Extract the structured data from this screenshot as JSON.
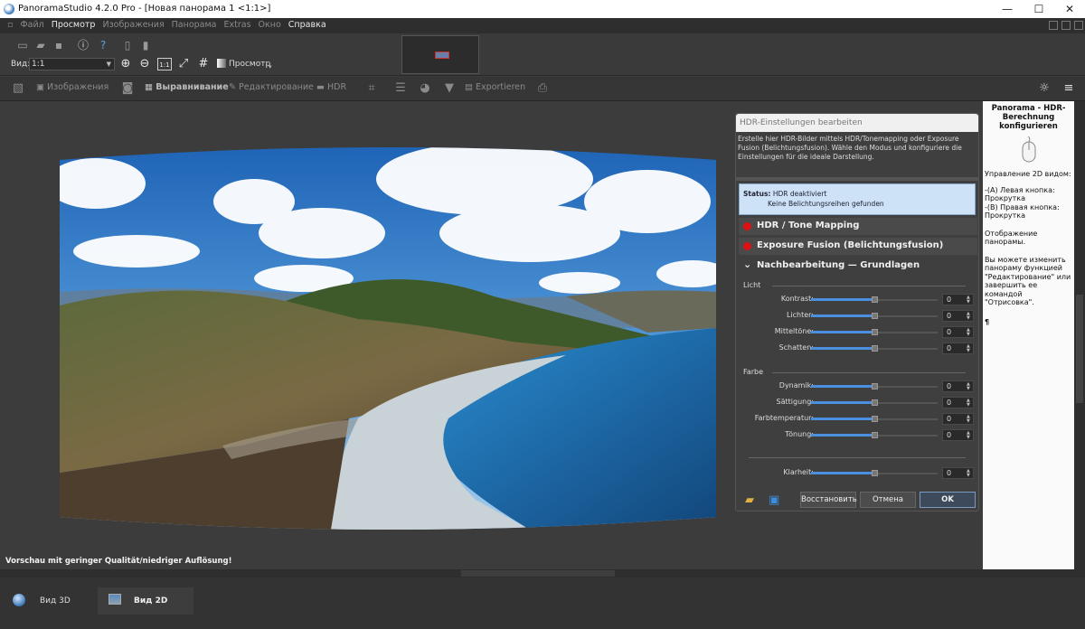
{
  "window": {
    "title": "PanoramaStudio 4.2.0 Pro - [Новая панорама 1 <1:1>]",
    "minimize": "—",
    "maximize": "☐",
    "close": "✕"
  },
  "menu": [
    "Файл",
    "Просмотр",
    "Изображения",
    "Панорама",
    "Extras",
    "Окно",
    "Справка"
  ],
  "toolbar": {
    "view_label": "Вид:",
    "zoom_value": "1:1",
    "zoom_1to1": "1:1",
    "preview_label": "Просмотр"
  },
  "workflow": {
    "images": "Изображения",
    "align": "Выравнивание",
    "edit": "Редактирование",
    "hdr": "HDR",
    "export": "Exportieren"
  },
  "canvas": {
    "preview_note": "Vorschau mit geringer Qualität/niedriger Auflösung!"
  },
  "help": {
    "title": "Panorama - HDR-Berechnung konfigurieren",
    "p1": "Управление 2D видом:",
    "p2": "-(A) Левая кнопка: Прокрутка",
    "p3": "-(B) Правая кнопка: Прокрутка",
    "p4": "Отображение панорамы.",
    "p5": "Вы можете изменить панораму функцией \"Редактирование\" или завершить ее командой \"Отрисовка\".",
    "symbol": "¶"
  },
  "dialog": {
    "title": "HDR-Einstellungen bearbeiten",
    "description": "Erstelle hier HDR-Bilder mittels HDR/Tonemapping oder Exposure Fusion (Belichtungsfusion). Wähle den Modus und konfiguriere die Einstellungen für die ideale Darstellung.",
    "status_label": "Status:",
    "status_line1": "HDR deaktiviert",
    "status_line2": "Keine Belichtungsreihen gefunden",
    "section_hdr": "HDR / Tone Mapping",
    "section_fusion": "Exposure Fusion (Belichtungsfusion)",
    "section_post": "Nachbearbeitung — Grundlagen",
    "group_light": "Licht",
    "group_color": "Farbe",
    "sliders_light": [
      {
        "label": "Kontrast:",
        "value": "0",
        "level": 0.5
      },
      {
        "label": "Lichter:",
        "value": "0",
        "level": 0.5
      },
      {
        "label": "Mitteltöne:",
        "value": "0",
        "level": 0.5
      },
      {
        "label": "Schatten:",
        "value": "0",
        "level": 0.5
      }
    ],
    "sliders_color": [
      {
        "label": "Dynamik:",
        "value": "0",
        "level": 0.5
      },
      {
        "label": "Sättigung:",
        "value": "0",
        "level": 0.5
      },
      {
        "label": "Farbtemperatur:",
        "value": "0",
        "level": 0.5
      },
      {
        "label": "Tönung:",
        "value": "0",
        "level": 0.5
      }
    ],
    "slider_clarity": {
      "label": "Klarheit:",
      "value": "0",
      "level": 0.5
    },
    "btn_reset": "Восстановить",
    "btn_cancel": "Отмена",
    "btn_ok": "OK"
  },
  "tabs": {
    "view3d": "Вид 3D",
    "view2d": "Вид 2D"
  },
  "colors": {
    "accent": "#4a8fe0",
    "status_bg": "#cde2f7",
    "dot_red": "#dd1111"
  }
}
